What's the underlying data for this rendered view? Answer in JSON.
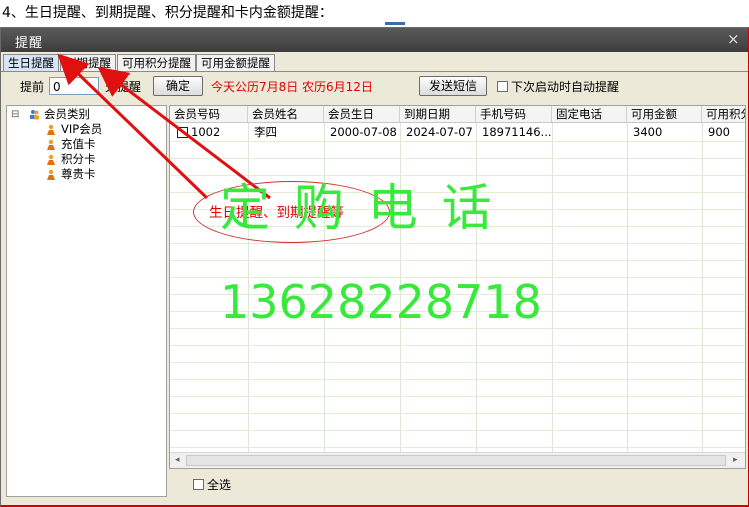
{
  "caption": "4、生日提醒、到期提醒、积分提醒和卡内金额提醒：",
  "window": {
    "title": "提醒",
    "close": "×"
  },
  "tabs": [
    {
      "label": "生日提醒",
      "active": true
    },
    {
      "label": "到期提醒",
      "active": false
    },
    {
      "label": "可用积分提醒",
      "active": false
    },
    {
      "label": "可用金额提醒",
      "active": false
    }
  ],
  "toolbar": {
    "advance_label": "提前",
    "days_value": "0",
    "days_suffix": "天提醒",
    "confirm_label": "确定",
    "solar_date": "今天公历7月8日",
    "lunar_date": "农历6月12日",
    "send_sms_label": "发送短信",
    "auto_remind_label": "下次启动时自动提醒"
  },
  "tree": {
    "expander": "⊟",
    "root": "会员类别",
    "children": [
      "VIP会员",
      "充值卡",
      "积分卡",
      "尊贵卡"
    ]
  },
  "table": {
    "headers": [
      "会员号码",
      "会员姓名",
      "会员生日",
      "到期日期",
      "手机号码",
      "固定电话",
      "可用金额",
      "可用积分"
    ],
    "rows": [
      {
        "card": "1002",
        "name": "李四",
        "birthday": "2000-07-08",
        "expiry": "2024-07-07",
        "mobile": "18971146...",
        "phone": "",
        "balance": "3400",
        "points": "900"
      }
    ]
  },
  "scroll": {
    "left": "◂",
    "right": "▸"
  },
  "select_all_label": "全选",
  "annotation": "生日提醒、到期提醒等",
  "watermark": {
    "line1": "定 购 电 话",
    "line2": "13628228718"
  },
  "colors": {
    "accent_red": "#e00000",
    "watermark_green": "#38e83b",
    "tab_active": "#d7e6f7"
  }
}
